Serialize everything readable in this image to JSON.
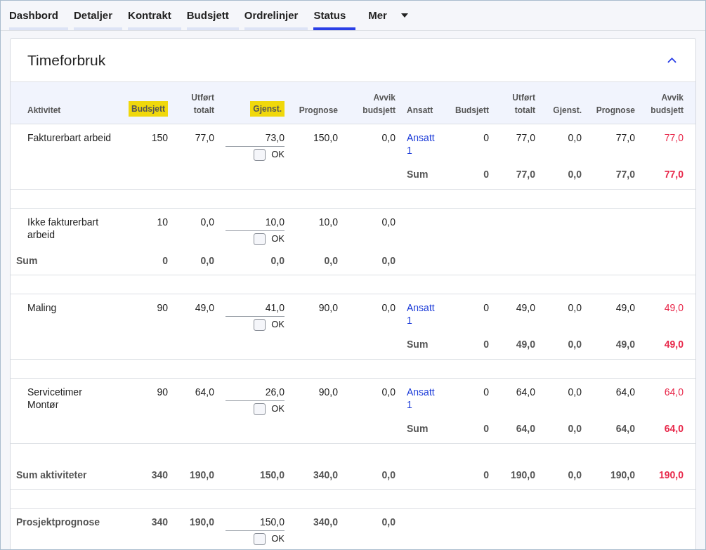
{
  "tabs": [
    {
      "label": "Dashbord",
      "selected": false
    },
    {
      "label": "Detaljer",
      "selected": false
    },
    {
      "label": "Kontrakt",
      "selected": false
    },
    {
      "label": "Budsjett",
      "selected": false
    },
    {
      "label": "Ordrelinjer",
      "selected": false
    },
    {
      "label": "Status",
      "selected": true
    }
  ],
  "more_menu": {
    "label": "Mer"
  },
  "panel": {
    "title": "Timeforbruk",
    "expanded": true
  },
  "columns": [
    {
      "label": "Aktivitet",
      "highlighted": false
    },
    {
      "label": "Budsjett",
      "highlighted": true
    },
    {
      "label": "Utført totalt",
      "highlighted": false
    },
    {
      "label": "Gjenst.",
      "highlighted": true
    },
    {
      "label": "Prognose",
      "highlighted": false
    },
    {
      "label": "Avvik budsjett",
      "highlighted": false
    },
    {
      "label": "Ansatt",
      "highlighted": false
    },
    {
      "label": "Budsjett",
      "highlighted": false
    },
    {
      "label": "Utført totalt",
      "highlighted": false
    },
    {
      "label": "Gjenst.",
      "highlighted": false
    },
    {
      "label": "Prognose",
      "highlighted": false
    },
    {
      "label": "Avvik budsjett",
      "highlighted": false
    }
  ],
  "groups": [
    {
      "name": "Fakturerbart arbeid",
      "budsjett": "150",
      "utfort": "77,0",
      "gjenst": "73,0",
      "ok": {
        "label": "OK",
        "checked": false
      },
      "prognose": "150,0",
      "avvik": "0,0",
      "employees": [
        {
          "name": "Ansatt 1",
          "values": [
            "0",
            "77,0",
            "0,0",
            "77,0",
            "77,0"
          ],
          "over_budget": true
        }
      ],
      "sum": {
        "kind": "employee",
        "label": "Sum",
        "values": [
          "0",
          "77,0",
          "0,0",
          "77,0",
          "77,0"
        ],
        "over_budget": true
      }
    },
    {
      "name": "Ikke fakturerbart arbeid",
      "budsjett": "10",
      "utfort": "0,0",
      "gjenst": "10,0",
      "ok": {
        "label": "OK",
        "checked": false
      },
      "prognose": "10,0",
      "avvik": "0,0",
      "sum": {
        "kind": "activity",
        "label": "Sum",
        "values": [
          "0",
          "0,0",
          "0,0",
          "0,0",
          "0,0"
        ]
      }
    },
    {
      "name": "Maling",
      "budsjett": "90",
      "utfort": "49,0",
      "gjenst": "41,0",
      "ok": {
        "label": "OK",
        "checked": false
      },
      "prognose": "90,0",
      "avvik": "0,0",
      "employees": [
        {
          "name": "Ansatt 1",
          "values": [
            "0",
            "49,0",
            "0,0",
            "49,0",
            "49,0"
          ],
          "over_budget": true
        }
      ],
      "sum": {
        "kind": "employee",
        "label": "Sum",
        "values": [
          "0",
          "49,0",
          "0,0",
          "49,0",
          "49,0"
        ],
        "over_budget": true
      }
    },
    {
      "name": "Servicetimer Montør",
      "budsjett": "90",
      "utfort": "64,0",
      "gjenst": "26,0",
      "ok": {
        "label": "OK",
        "checked": false
      },
      "prognose": "90,0",
      "avvik": "0,0",
      "employees": [
        {
          "name": "Ansatt 1",
          "values": [
            "0",
            "64,0",
            "0,0",
            "64,0",
            "64,0"
          ],
          "over_budget": true
        }
      ],
      "sum": {
        "kind": "employee",
        "label": "Sum",
        "values": [
          "0",
          "64,0",
          "0,0",
          "64,0",
          "64,0"
        ],
        "over_budget": true
      }
    }
  ],
  "totals": {
    "label": "Sum aktiviteter",
    "values": [
      "340",
      "190,0",
      "150,0",
      "340,0",
      "0,0"
    ],
    "employee_values": [
      "0",
      "190,0",
      "0,0",
      "190,0",
      "190,0"
    ],
    "over_budget": true
  },
  "forecast": {
    "label": "Prosjektprognose",
    "budsjett": "340",
    "utfort": "190,0",
    "gjenst": "150,0",
    "ok": {
      "label": "OK",
      "checked": false
    },
    "prognose": "340,0",
    "avvik": "0,0"
  }
}
